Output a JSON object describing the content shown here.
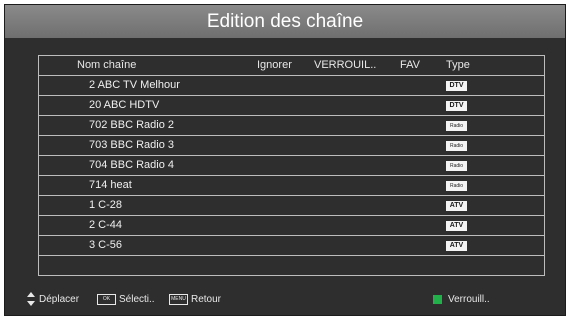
{
  "title": "Edition des chaîne",
  "columns": {
    "name": "Nom chaîne",
    "ignore": "Ignorer",
    "lock": "VERROUIL..",
    "fav": "FAV",
    "type": "Type"
  },
  "channels": [
    {
      "name": "2  ABC  TV Melhour",
      "type": "DTV"
    },
    {
      "name": "20  ABC HDTV",
      "type": "DTV"
    },
    {
      "name": "702  BBC Radio 2",
      "type": "Radio"
    },
    {
      "name": "703  BBC Radio 3",
      "type": "Radio"
    },
    {
      "name": "704  BBC Radio 4",
      "type": "Radio"
    },
    {
      "name": "714  heat",
      "type": "Radio"
    },
    {
      "name": "1  C-28",
      "type": "ATV"
    },
    {
      "name": "2  C-44",
      "type": "ATV"
    },
    {
      "name": "3  C-56",
      "type": "ATV"
    }
  ],
  "footer": {
    "move_label": "Déplacer",
    "ok_key": "OK",
    "select_label": "Sélecti..",
    "menu_key": "MENU",
    "back_label": "Retour",
    "lock_label": "Verrouill.."
  },
  "colors": {
    "background": "#2e2e2e",
    "title_bar": "#7a7a7a",
    "grid_line": "#bdbdbd",
    "lock_key": "#22b04a"
  },
  "icons": {
    "move": "up-down-arrows-icon",
    "ok": "ok-key-icon",
    "menu": "menu-key-icon",
    "lock": "green-key-icon"
  }
}
